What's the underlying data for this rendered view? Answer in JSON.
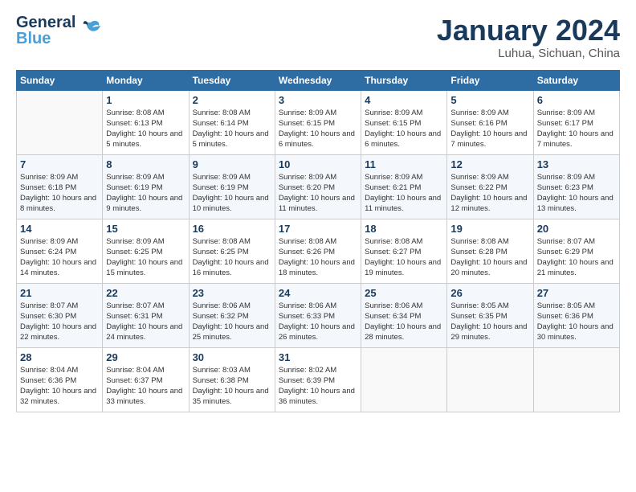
{
  "logo": {
    "general": "General",
    "blue": "Blue"
  },
  "title": "January 2024",
  "location": "Luhua, Sichuan, China",
  "weekdays": [
    "Sunday",
    "Monday",
    "Tuesday",
    "Wednesday",
    "Thursday",
    "Friday",
    "Saturday"
  ],
  "weeks": [
    [
      {
        "day": "",
        "sunrise": "",
        "sunset": "",
        "daylight": ""
      },
      {
        "day": "1",
        "sunrise": "Sunrise: 8:08 AM",
        "sunset": "Sunset: 6:13 PM",
        "daylight": "Daylight: 10 hours and 5 minutes."
      },
      {
        "day": "2",
        "sunrise": "Sunrise: 8:08 AM",
        "sunset": "Sunset: 6:14 PM",
        "daylight": "Daylight: 10 hours and 5 minutes."
      },
      {
        "day": "3",
        "sunrise": "Sunrise: 8:09 AM",
        "sunset": "Sunset: 6:15 PM",
        "daylight": "Daylight: 10 hours and 6 minutes."
      },
      {
        "day": "4",
        "sunrise": "Sunrise: 8:09 AM",
        "sunset": "Sunset: 6:15 PM",
        "daylight": "Daylight: 10 hours and 6 minutes."
      },
      {
        "day": "5",
        "sunrise": "Sunrise: 8:09 AM",
        "sunset": "Sunset: 6:16 PM",
        "daylight": "Daylight: 10 hours and 7 minutes."
      },
      {
        "day": "6",
        "sunrise": "Sunrise: 8:09 AM",
        "sunset": "Sunset: 6:17 PM",
        "daylight": "Daylight: 10 hours and 7 minutes."
      }
    ],
    [
      {
        "day": "7",
        "sunrise": "Sunrise: 8:09 AM",
        "sunset": "Sunset: 6:18 PM",
        "daylight": "Daylight: 10 hours and 8 minutes."
      },
      {
        "day": "8",
        "sunrise": "Sunrise: 8:09 AM",
        "sunset": "Sunset: 6:19 PM",
        "daylight": "Daylight: 10 hours and 9 minutes."
      },
      {
        "day": "9",
        "sunrise": "Sunrise: 8:09 AM",
        "sunset": "Sunset: 6:19 PM",
        "daylight": "Daylight: 10 hours and 10 minutes."
      },
      {
        "day": "10",
        "sunrise": "Sunrise: 8:09 AM",
        "sunset": "Sunset: 6:20 PM",
        "daylight": "Daylight: 10 hours and 11 minutes."
      },
      {
        "day": "11",
        "sunrise": "Sunrise: 8:09 AM",
        "sunset": "Sunset: 6:21 PM",
        "daylight": "Daylight: 10 hours and 11 minutes."
      },
      {
        "day": "12",
        "sunrise": "Sunrise: 8:09 AM",
        "sunset": "Sunset: 6:22 PM",
        "daylight": "Daylight: 10 hours and 12 minutes."
      },
      {
        "day": "13",
        "sunrise": "Sunrise: 8:09 AM",
        "sunset": "Sunset: 6:23 PM",
        "daylight": "Daylight: 10 hours and 13 minutes."
      }
    ],
    [
      {
        "day": "14",
        "sunrise": "Sunrise: 8:09 AM",
        "sunset": "Sunset: 6:24 PM",
        "daylight": "Daylight: 10 hours and 14 minutes."
      },
      {
        "day": "15",
        "sunrise": "Sunrise: 8:09 AM",
        "sunset": "Sunset: 6:25 PM",
        "daylight": "Daylight: 10 hours and 15 minutes."
      },
      {
        "day": "16",
        "sunrise": "Sunrise: 8:08 AM",
        "sunset": "Sunset: 6:25 PM",
        "daylight": "Daylight: 10 hours and 16 minutes."
      },
      {
        "day": "17",
        "sunrise": "Sunrise: 8:08 AM",
        "sunset": "Sunset: 6:26 PM",
        "daylight": "Daylight: 10 hours and 18 minutes."
      },
      {
        "day": "18",
        "sunrise": "Sunrise: 8:08 AM",
        "sunset": "Sunset: 6:27 PM",
        "daylight": "Daylight: 10 hours and 19 minutes."
      },
      {
        "day": "19",
        "sunrise": "Sunrise: 8:08 AM",
        "sunset": "Sunset: 6:28 PM",
        "daylight": "Daylight: 10 hours and 20 minutes."
      },
      {
        "day": "20",
        "sunrise": "Sunrise: 8:07 AM",
        "sunset": "Sunset: 6:29 PM",
        "daylight": "Daylight: 10 hours and 21 minutes."
      }
    ],
    [
      {
        "day": "21",
        "sunrise": "Sunrise: 8:07 AM",
        "sunset": "Sunset: 6:30 PM",
        "daylight": "Daylight: 10 hours and 22 minutes."
      },
      {
        "day": "22",
        "sunrise": "Sunrise: 8:07 AM",
        "sunset": "Sunset: 6:31 PM",
        "daylight": "Daylight: 10 hours and 24 minutes."
      },
      {
        "day": "23",
        "sunrise": "Sunrise: 8:06 AM",
        "sunset": "Sunset: 6:32 PM",
        "daylight": "Daylight: 10 hours and 25 minutes."
      },
      {
        "day": "24",
        "sunrise": "Sunrise: 8:06 AM",
        "sunset": "Sunset: 6:33 PM",
        "daylight": "Daylight: 10 hours and 26 minutes."
      },
      {
        "day": "25",
        "sunrise": "Sunrise: 8:06 AM",
        "sunset": "Sunset: 6:34 PM",
        "daylight": "Daylight: 10 hours and 28 minutes."
      },
      {
        "day": "26",
        "sunrise": "Sunrise: 8:05 AM",
        "sunset": "Sunset: 6:35 PM",
        "daylight": "Daylight: 10 hours and 29 minutes."
      },
      {
        "day": "27",
        "sunrise": "Sunrise: 8:05 AM",
        "sunset": "Sunset: 6:36 PM",
        "daylight": "Daylight: 10 hours and 30 minutes."
      }
    ],
    [
      {
        "day": "28",
        "sunrise": "Sunrise: 8:04 AM",
        "sunset": "Sunset: 6:36 PM",
        "daylight": "Daylight: 10 hours and 32 minutes."
      },
      {
        "day": "29",
        "sunrise": "Sunrise: 8:04 AM",
        "sunset": "Sunset: 6:37 PM",
        "daylight": "Daylight: 10 hours and 33 minutes."
      },
      {
        "day": "30",
        "sunrise": "Sunrise: 8:03 AM",
        "sunset": "Sunset: 6:38 PM",
        "daylight": "Daylight: 10 hours and 35 minutes."
      },
      {
        "day": "31",
        "sunrise": "Sunrise: 8:02 AM",
        "sunset": "Sunset: 6:39 PM",
        "daylight": "Daylight: 10 hours and 36 minutes."
      },
      {
        "day": "",
        "sunrise": "",
        "sunset": "",
        "daylight": ""
      },
      {
        "day": "",
        "sunrise": "",
        "sunset": "",
        "daylight": ""
      },
      {
        "day": "",
        "sunrise": "",
        "sunset": "",
        "daylight": ""
      }
    ]
  ]
}
